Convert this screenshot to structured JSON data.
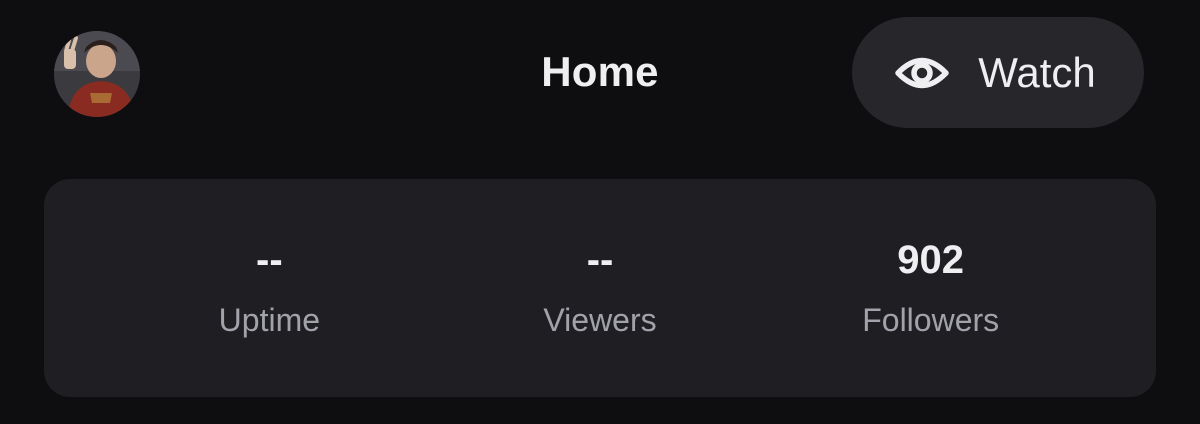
{
  "header": {
    "title": "Home",
    "avatar_icon": "user-avatar",
    "watch_button": {
      "label": "Watch",
      "icon": "eye-icon"
    }
  },
  "stats": [
    {
      "value": "--",
      "label": "Uptime"
    },
    {
      "value": "--",
      "label": "Viewers"
    },
    {
      "value": "902",
      "label": "Followers"
    }
  ],
  "colors": {
    "background": "#0e0e10",
    "card": "#1f1f23",
    "button": "#26262b",
    "text": "#efeff1",
    "muted": "#a2a2ab"
  }
}
